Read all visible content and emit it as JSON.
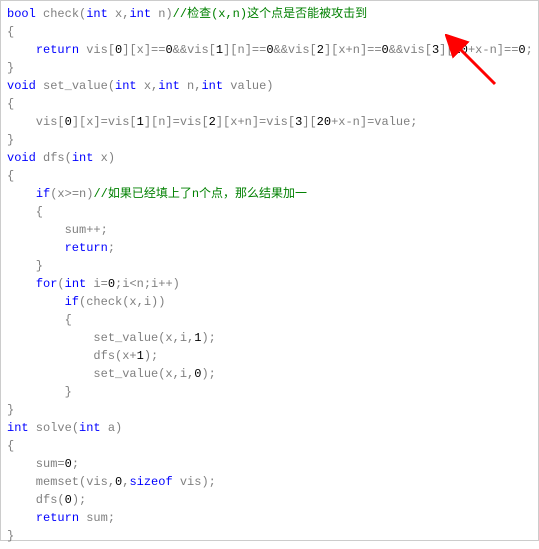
{
  "code": {
    "lines": [
      {
        "segments": [
          {
            "t": "bool",
            "c": "kw"
          },
          {
            "t": " check(",
            "c": ""
          },
          {
            "t": "int",
            "c": "kw"
          },
          {
            "t": " x,",
            "c": ""
          },
          {
            "t": "int",
            "c": "kw"
          },
          {
            "t": " n)",
            "c": ""
          },
          {
            "t": "//检查(x,n)这个点是否能被攻击到",
            "c": "cm"
          }
        ]
      },
      {
        "segments": [
          {
            "t": "{",
            "c": ""
          }
        ]
      },
      {
        "segments": [
          {
            "t": "    ",
            "c": ""
          },
          {
            "t": "return",
            "c": "kw"
          },
          {
            "t": " vis[",
            "c": ""
          },
          {
            "t": "0",
            "c": "num"
          },
          {
            "t": "][x]==",
            "c": ""
          },
          {
            "t": "0",
            "c": "num"
          },
          {
            "t": "&&vis[",
            "c": ""
          },
          {
            "t": "1",
            "c": "num"
          },
          {
            "t": "][n]==",
            "c": ""
          },
          {
            "t": "0",
            "c": "num"
          },
          {
            "t": "&&vis[",
            "c": ""
          },
          {
            "t": "2",
            "c": "num"
          },
          {
            "t": "][x+n]==",
            "c": ""
          },
          {
            "t": "0",
            "c": "num"
          },
          {
            "t": "&&vis[",
            "c": ""
          },
          {
            "t": "3",
            "c": "num"
          },
          {
            "t": "][",
            "c": ""
          },
          {
            "t": "20",
            "c": "num"
          },
          {
            "t": "+x-n]==",
            "c": ""
          },
          {
            "t": "0",
            "c": "num"
          },
          {
            "t": ";",
            "c": ""
          }
        ]
      },
      {
        "segments": [
          {
            "t": "}",
            "c": ""
          }
        ]
      },
      {
        "segments": [
          {
            "t": "void",
            "c": "kw"
          },
          {
            "t": " set_value(",
            "c": ""
          },
          {
            "t": "int",
            "c": "kw"
          },
          {
            "t": " x,",
            "c": ""
          },
          {
            "t": "int",
            "c": "kw"
          },
          {
            "t": " n,",
            "c": ""
          },
          {
            "t": "int",
            "c": "kw"
          },
          {
            "t": " value)",
            "c": ""
          }
        ]
      },
      {
        "segments": [
          {
            "t": "{",
            "c": ""
          }
        ]
      },
      {
        "segments": [
          {
            "t": "    vis[",
            "c": ""
          },
          {
            "t": "0",
            "c": "num"
          },
          {
            "t": "][x]=vis[",
            "c": ""
          },
          {
            "t": "1",
            "c": "num"
          },
          {
            "t": "][n]=vis[",
            "c": ""
          },
          {
            "t": "2",
            "c": "num"
          },
          {
            "t": "][x+n]=vis[",
            "c": ""
          },
          {
            "t": "3",
            "c": "num"
          },
          {
            "t": "][",
            "c": ""
          },
          {
            "t": "20",
            "c": "num"
          },
          {
            "t": "+x-n]=value;",
            "c": ""
          }
        ]
      },
      {
        "segments": [
          {
            "t": "}",
            "c": ""
          }
        ]
      },
      {
        "segments": [
          {
            "t": "void",
            "c": "kw"
          },
          {
            "t": " dfs(",
            "c": ""
          },
          {
            "t": "int",
            "c": "kw"
          },
          {
            "t": " x)",
            "c": ""
          }
        ]
      },
      {
        "segments": [
          {
            "t": "{",
            "c": ""
          }
        ]
      },
      {
        "segments": [
          {
            "t": "    ",
            "c": ""
          },
          {
            "t": "if",
            "c": "kw"
          },
          {
            "t": "(x>=n)",
            "c": ""
          },
          {
            "t": "//如果已经填上了n个点，那么结果加一",
            "c": "cm"
          }
        ]
      },
      {
        "segments": [
          {
            "t": "    {",
            "c": ""
          }
        ]
      },
      {
        "segments": [
          {
            "t": "        sum++;",
            "c": ""
          }
        ]
      },
      {
        "segments": [
          {
            "t": "        ",
            "c": ""
          },
          {
            "t": "return",
            "c": "kw"
          },
          {
            "t": ";",
            "c": ""
          }
        ]
      },
      {
        "segments": [
          {
            "t": "    }",
            "c": ""
          }
        ]
      },
      {
        "segments": [
          {
            "t": "    ",
            "c": ""
          },
          {
            "t": "for",
            "c": "kw"
          },
          {
            "t": "(",
            "c": ""
          },
          {
            "t": "int",
            "c": "kw"
          },
          {
            "t": " i=",
            "c": ""
          },
          {
            "t": "0",
            "c": "num"
          },
          {
            "t": ";i<n;i++)",
            "c": ""
          }
        ]
      },
      {
        "segments": [
          {
            "t": "        ",
            "c": ""
          },
          {
            "t": "if",
            "c": "kw"
          },
          {
            "t": "(check(x,i))",
            "c": ""
          }
        ]
      },
      {
        "segments": [
          {
            "t": "        {",
            "c": ""
          }
        ]
      },
      {
        "segments": [
          {
            "t": "            set_value(x,i,",
            "c": ""
          },
          {
            "t": "1",
            "c": "num"
          },
          {
            "t": ");",
            "c": ""
          }
        ]
      },
      {
        "segments": [
          {
            "t": "            dfs(x+",
            "c": ""
          },
          {
            "t": "1",
            "c": "num"
          },
          {
            "t": ");",
            "c": ""
          }
        ]
      },
      {
        "segments": [
          {
            "t": "            set_value(x,i,",
            "c": ""
          },
          {
            "t": "0",
            "c": "num"
          },
          {
            "t": ");",
            "c": ""
          }
        ]
      },
      {
        "segments": [
          {
            "t": "        }",
            "c": ""
          }
        ]
      },
      {
        "segments": [
          {
            "t": "}",
            "c": ""
          }
        ]
      },
      {
        "segments": [
          {
            "t": "int",
            "c": "kw"
          },
          {
            "t": " solve(",
            "c": ""
          },
          {
            "t": "int",
            "c": "kw"
          },
          {
            "t": " a)",
            "c": ""
          }
        ]
      },
      {
        "segments": [
          {
            "t": "{",
            "c": ""
          }
        ]
      },
      {
        "segments": [
          {
            "t": "    sum=",
            "c": ""
          },
          {
            "t": "0",
            "c": "num"
          },
          {
            "t": ";",
            "c": ""
          }
        ]
      },
      {
        "segments": [
          {
            "t": "    memset(vis,",
            "c": ""
          },
          {
            "t": "0",
            "c": "num"
          },
          {
            "t": ",",
            "c": ""
          },
          {
            "t": "sizeof",
            "c": "kw"
          },
          {
            "t": " vis);",
            "c": ""
          }
        ]
      },
      {
        "segments": [
          {
            "t": "    dfs(",
            "c": ""
          },
          {
            "t": "0",
            "c": "num"
          },
          {
            "t": ");",
            "c": ""
          }
        ]
      },
      {
        "segments": [
          {
            "t": "    ",
            "c": ""
          },
          {
            "t": "return",
            "c": "kw"
          },
          {
            "t": " sum;",
            "c": ""
          }
        ]
      },
      {
        "segments": [
          {
            "t": "}",
            "c": ""
          }
        ]
      }
    ]
  },
  "arrow": {
    "color": "#ff0000",
    "points_to": "vis[3][20+x-n]==0"
  }
}
